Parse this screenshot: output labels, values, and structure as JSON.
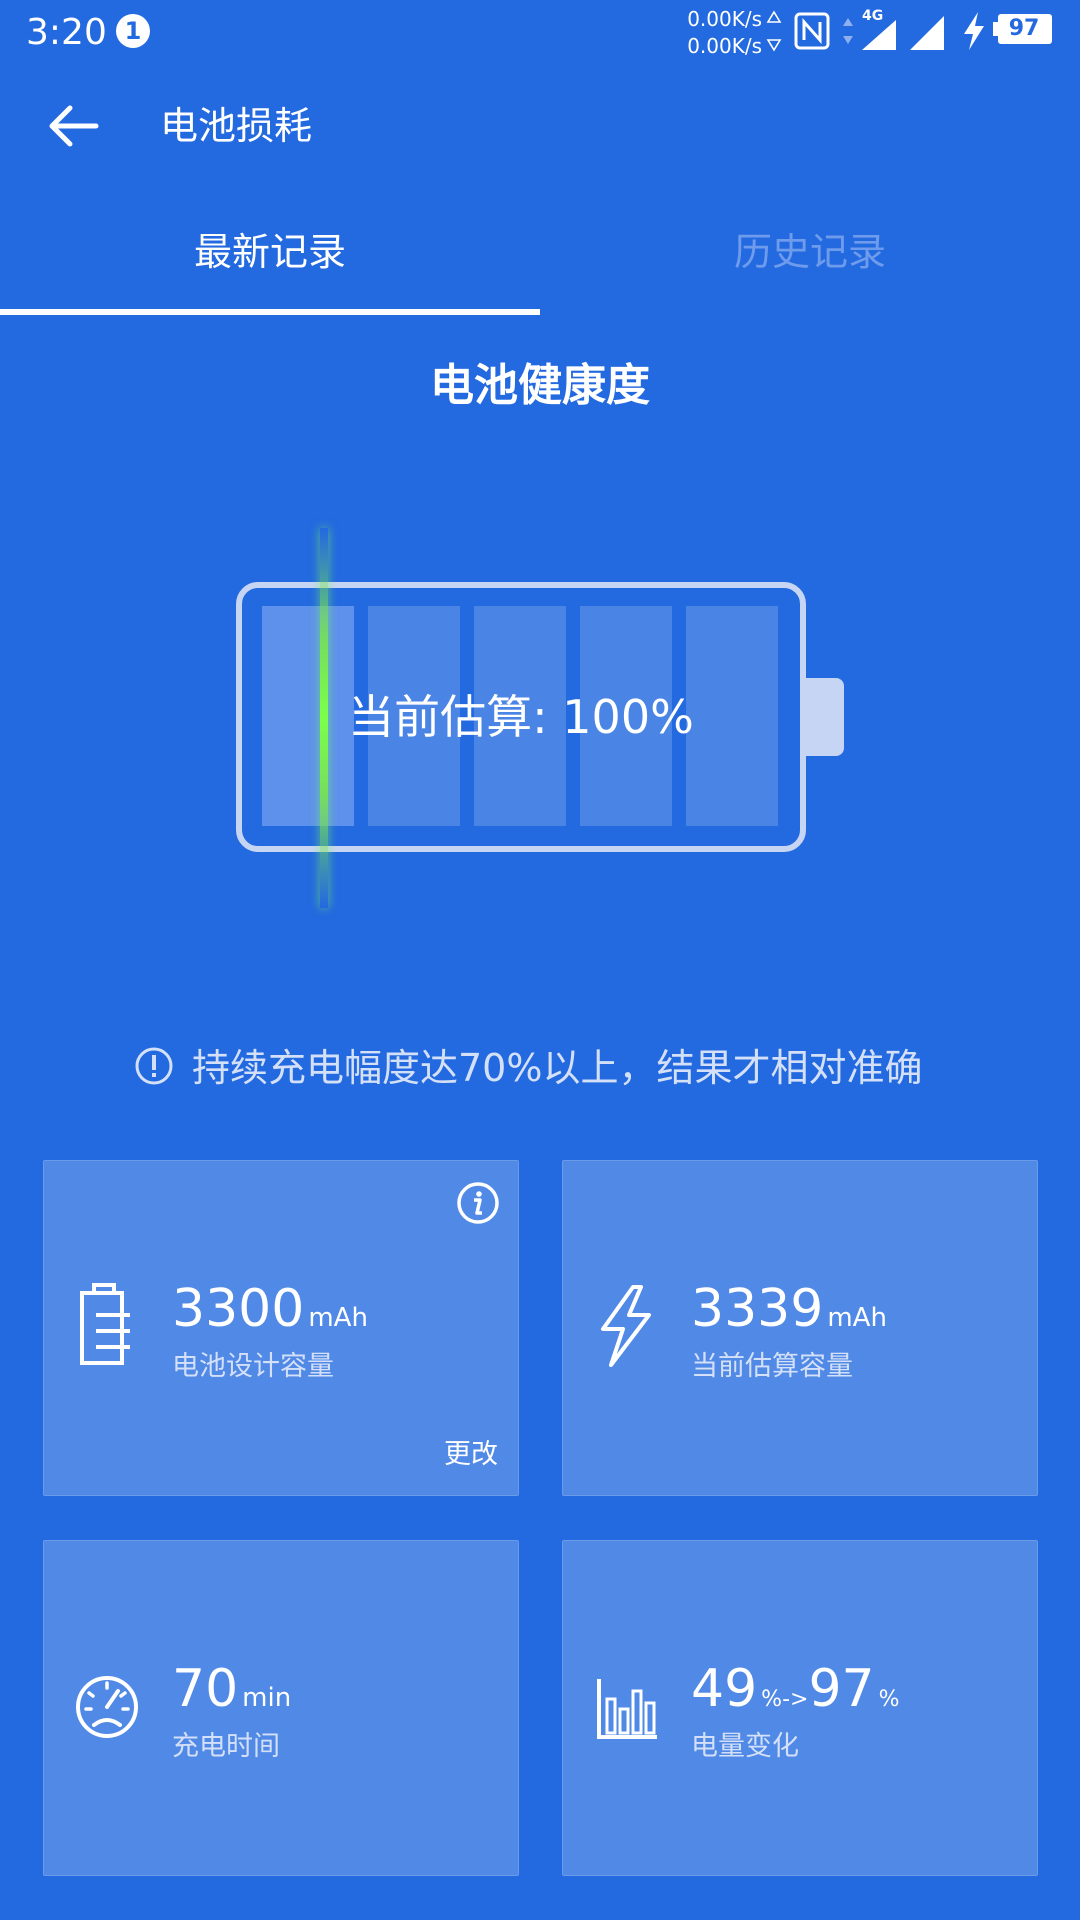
{
  "status_bar": {
    "time": "3:20",
    "notification_count": "1",
    "upload_speed": "0.00K/s",
    "download_speed": "0.00K/s",
    "network_type": "4G",
    "battery_level": "97",
    "icons": [
      "nfc-icon",
      "data-arrows-icon",
      "signal-4g-icon",
      "signal-icon",
      "charging-bolt-icon",
      "battery-icon"
    ]
  },
  "app_bar": {
    "title": "电池损耗"
  },
  "tabs": [
    {
      "label": "最新记录",
      "active": true
    },
    {
      "label": "历史记录",
      "active": false
    }
  ],
  "health": {
    "title": "电池健康度",
    "estimate_text": "当前估算: 100%",
    "estimate_percent": 100
  },
  "notice": {
    "text": "持续充电幅度达70%以上，结果才相对准确"
  },
  "cards": {
    "design_capacity": {
      "value": "3300",
      "unit": "mAh",
      "label": "电池设计容量",
      "action_label": "更改"
    },
    "estimated_capacity": {
      "value": "3339",
      "unit": "mAh",
      "label": "当前估算容量"
    },
    "charge_time": {
      "value": "70",
      "unit": "min",
      "label": "充电时间"
    },
    "level_change": {
      "from": "49",
      "arrow": "%->",
      "to": "97",
      "unit": "%",
      "label": "电量变化"
    }
  },
  "colors": {
    "background": "#2369e0",
    "card": "#5089e6",
    "inactive_tab": "#6e9bec",
    "scan_line": "#7dff4a",
    "battery_outline": "#c7d5f5"
  }
}
